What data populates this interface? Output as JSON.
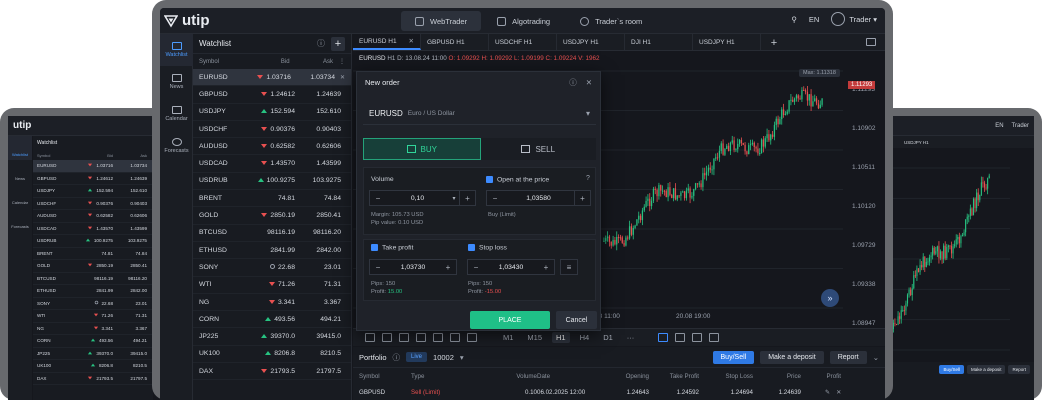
{
  "app": {
    "logo": "utip"
  },
  "top_tabs": [
    {
      "label": "WebTrader",
      "active": true
    },
    {
      "label": "Algotrading"
    },
    {
      "label": "Trader`s room"
    }
  ],
  "top_right": {
    "lang": "EN",
    "user": "Trader"
  },
  "nav": [
    {
      "label": "Watchlist",
      "icon": "watchlist-icon",
      "active": true
    },
    {
      "label": "News",
      "icon": "news-icon"
    },
    {
      "label": "Calendar",
      "icon": "calendar-icon"
    },
    {
      "label": "Forecasts",
      "icon": "forecasts-icon"
    }
  ],
  "watchlist": {
    "title": "Watchlist",
    "columns": [
      "Symbol",
      "Bid",
      "Ask"
    ],
    "rows": [
      {
        "symbol": "EURUSD",
        "bid": "1.03716",
        "ask": "1.03734",
        "dir": "down",
        "selected": true
      },
      {
        "symbol": "GBPUSD",
        "bid": "1.24612",
        "ask": "1.24639",
        "dir": "down"
      },
      {
        "symbol": "USDJPY",
        "bid": "152.594",
        "ask": "152.610",
        "dir": "up"
      },
      {
        "symbol": "USDCHF",
        "bid": "0.90376",
        "ask": "0.90403",
        "dir": "down"
      },
      {
        "symbol": "AUDUSD",
        "bid": "0.62582",
        "ask": "0.62606",
        "dir": "down"
      },
      {
        "symbol": "USDCAD",
        "bid": "1.43570",
        "ask": "1.43599",
        "dir": "down"
      },
      {
        "symbol": "USDRUB",
        "bid": "100.9275",
        "ask": "103.9275",
        "dir": "up"
      },
      {
        "symbol": "BRENT",
        "bid": "74.81",
        "ask": "74.84",
        "dir": "none"
      },
      {
        "symbol": "GOLD",
        "bid": "2850.19",
        "ask": "2850.41",
        "dir": "down"
      },
      {
        "symbol": "BTCUSD",
        "bid": "98116.19",
        "ask": "98116.20",
        "dir": "none"
      },
      {
        "symbol": "ETHUSD",
        "bid": "2841.99",
        "ask": "2842.00",
        "dir": "none"
      },
      {
        "symbol": "SONY",
        "bid": "22.68",
        "ask": "23.01",
        "dir": "neutral"
      },
      {
        "symbol": "WTI",
        "bid": "71.26",
        "ask": "71.31",
        "dir": "down"
      },
      {
        "symbol": "NG",
        "bid": "3.341",
        "ask": "3.367",
        "dir": "down"
      },
      {
        "symbol": "CORN",
        "bid": "493.56",
        "ask": "494.21",
        "dir": "up"
      },
      {
        "symbol": "JP225",
        "bid": "39370.0",
        "ask": "39415.0",
        "dir": "up"
      },
      {
        "symbol": "UK100",
        "bid": "8206.8",
        "ask": "8210.5",
        "dir": "up"
      },
      {
        "symbol": "DAX",
        "bid": "21793.5",
        "ask": "21797.5",
        "dir": "down"
      }
    ]
  },
  "chart_tabs": [
    {
      "label": "EURUSD H1",
      "active": true
    },
    {
      "label": "GBPUSD H1"
    },
    {
      "label": "USDCHF H1"
    },
    {
      "label": "USDJPY H1"
    },
    {
      "label": "DJI H1"
    },
    {
      "label": "USDJPY H1"
    }
  ],
  "chart_info": {
    "symbol": "EURUSD",
    "tf": "H1",
    "d": "D: 13.08.24 11:00",
    "o": "O: 1.09292",
    "h": "H: 1.09292",
    "l": "L: 1.09199",
    "c": "C: 1.09224",
    "v": "V: 1962"
  },
  "chart_data": {
    "type": "candlestick",
    "y_ticks": [
      "1.11293",
      "1.10902",
      "1.10511",
      "1.10120",
      "1.09729",
      "1.09338",
      "1.08947"
    ],
    "x_ticks": [
      "14.08 18:00",
      "16.08 02:00",
      "19.08 11:00",
      "20.08 19:00"
    ],
    "max_label": "Max: 1.11318",
    "last_price": "1.11293"
  },
  "timeframes": [
    "M1",
    "M15",
    "H1",
    "H4",
    "D1",
    "···"
  ],
  "active_tf": "H1",
  "new_order": {
    "title": "New order",
    "symbol": "EURUSD",
    "symbol_desc": "Euro / US Dollar",
    "buy": "BUY",
    "sell": "SELL",
    "volume_label": "Volume",
    "volume": "0,10",
    "margin": "Margin: 105.73 USD",
    "pip_value": "Pip value: 0.10 USD",
    "open_price_label": "Open at the price",
    "open_price": "1,03580",
    "order_type": "Buy (Limit)",
    "tp_label": "Take profit",
    "tp": "1,03730",
    "tp_pips": "Pips: 150",
    "tp_profit_label": "Profit:",
    "tp_profit": "15.00",
    "sl_label": "Stop loss",
    "sl": "1,03430",
    "sl_pips": "Pips: 150",
    "sl_profit_label": "Profit:",
    "sl_profit": "-15.00",
    "place": "PLACE",
    "cancel": "Cancel"
  },
  "portfolio": {
    "title": "Portfolio",
    "mode": "Live",
    "account": "10002",
    "buy_sell": "Buy/Sell",
    "deposit": "Make a deposit",
    "report": "Report",
    "columns": [
      "Symbol",
      "Type",
      "Volume",
      "Date",
      "Opening",
      "Take Profit",
      "Stop Loss",
      "Price",
      "Profit"
    ],
    "rows": [
      {
        "symbol": "GBPUSD",
        "type": "Sell (Limit)",
        "volume": "0.10",
        "date": "06.02.2025 12:00",
        "opening": "1.24643",
        "tp": "1.24592",
        "sl": "1.24694",
        "price": "1.24639"
      }
    ]
  },
  "colors": {
    "bg": "#15171d",
    "up": "#27c281",
    "down": "#e85050",
    "accent": "#3d8bff",
    "place": "#1fbf87"
  }
}
